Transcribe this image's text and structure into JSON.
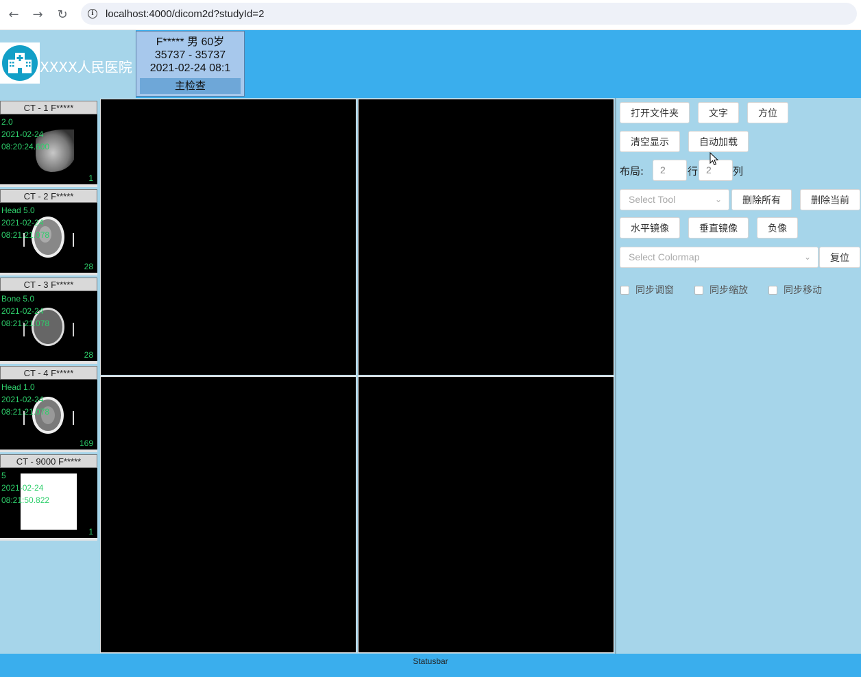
{
  "browser": {
    "url": "localhost:4000/dicom2d?studyId=2"
  },
  "header": {
    "hospital_name": "XXXX人民医院",
    "patient": {
      "line1": "F***** 男   60岁",
      "line2": "35737  -  35737",
      "line3": "2021-02-24 08:1",
      "exam_label": "主检查"
    }
  },
  "series": [
    {
      "title": "CT - 1 F*****",
      "desc": "2.0",
      "date": "2021-02-24",
      "time": "08:20:24.600",
      "count": "1"
    },
    {
      "title": "CT - 2 F*****",
      "desc": "Head 5.0",
      "date": "2021-02-24",
      "time": "08:21:21.078",
      "count": "28"
    },
    {
      "title": "CT - 3 F*****",
      "desc": "Bone 5.0",
      "date": "2021-02-24",
      "time": "08:21:21.078",
      "count": "28"
    },
    {
      "title": "CT - 4 F*****",
      "desc": "Head 1.0",
      "date": "2021-02-24",
      "time": "08:21:21.078",
      "count": "169"
    },
    {
      "title": "CT - 9000 F*****",
      "desc": "5",
      "date": "2021-02-24",
      "time": "08:21:50.822",
      "count": "1"
    }
  ],
  "tools": {
    "open_folder": "打开文件夹",
    "text": "文字",
    "orientation": "方位",
    "clear_display": "清空显示",
    "auto_load": "自动加载",
    "layout_label": "布局:",
    "rows_value": "2",
    "rows_label": "行",
    "cols_value": "2",
    "cols_label": "列",
    "select_tool_placeholder": "Select Tool",
    "delete_all": "删除所有",
    "delete_current": "删除当前",
    "flip_horizontal": "水平镜像",
    "flip_vertical": "垂直镜像",
    "invert": "负像",
    "select_colormap_placeholder": "Select Colormap",
    "reset": "复位",
    "sync_window": "同步调窗",
    "sync_zoom": "同步缩放",
    "sync_pan": "同步移动"
  },
  "statusbar": {
    "text": "Statusbar"
  }
}
